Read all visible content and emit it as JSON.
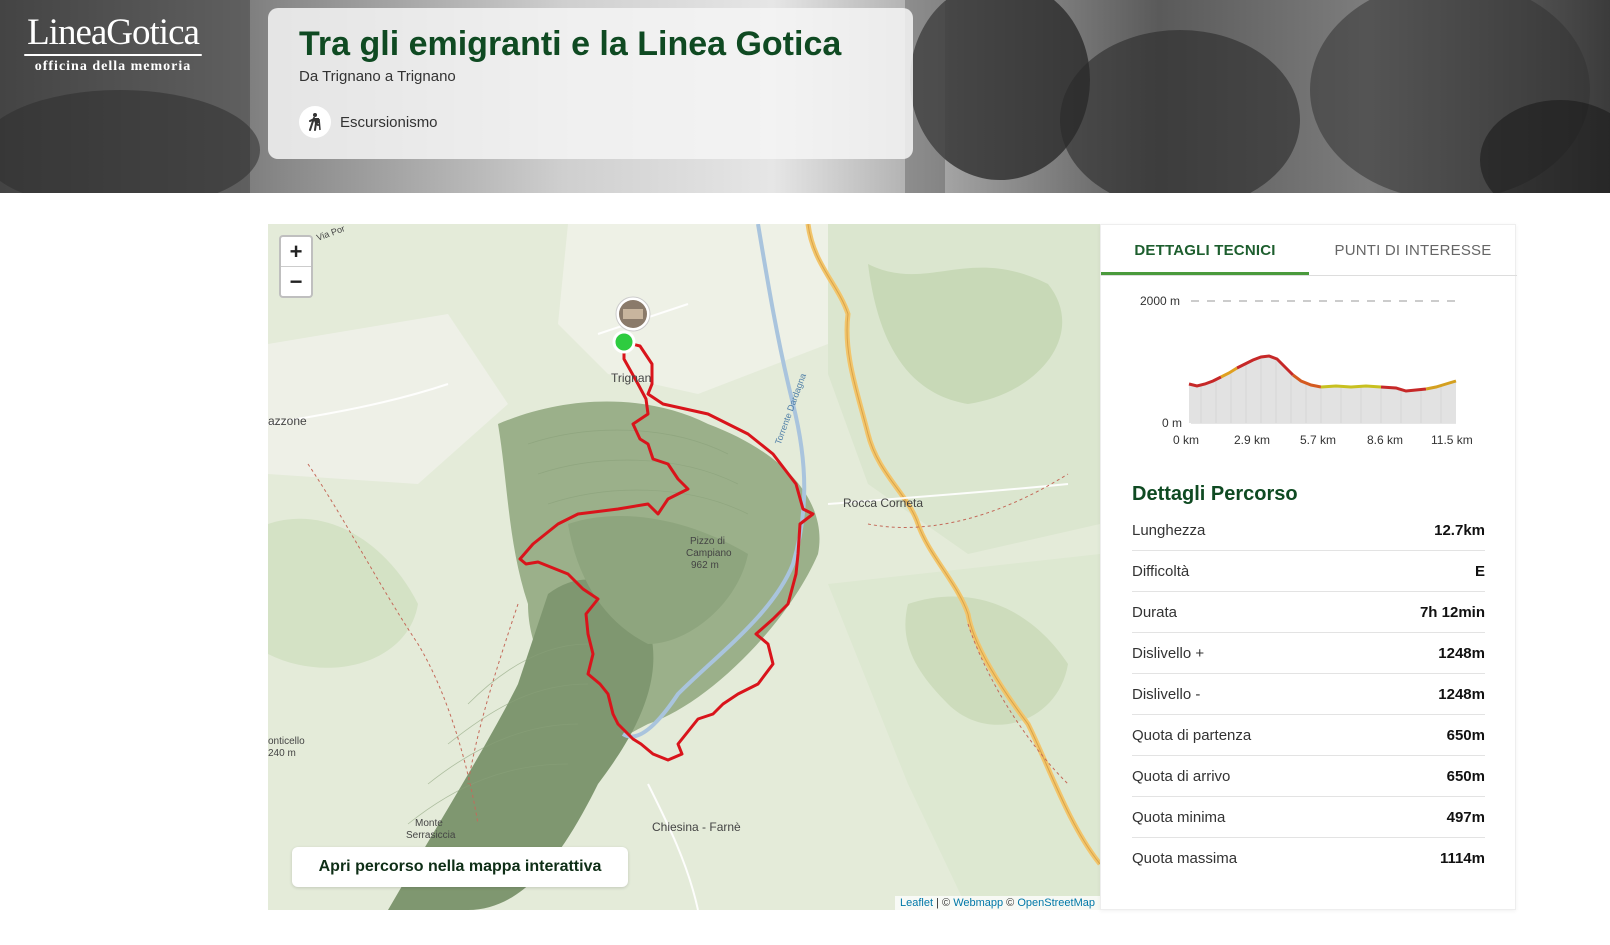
{
  "hero": {
    "logo": {
      "name": "LineaGotica",
      "tagline": "officina della memoria"
    },
    "title": "Tra gli emigranti e la Linea Gotica",
    "subtitle": "Da Trignano a Trignano",
    "activity": {
      "icon": "hiking-icon",
      "label": "Escursionismo"
    }
  },
  "map": {
    "zoom_in": "+",
    "zoom_out": "−",
    "labels": {
      "trignano": "Trignan",
      "rocca": "Rocca Corneta",
      "pizzo": "Pizzo di",
      "pizzo2": "Campiano",
      "pizzo3": "962 m",
      "chiesina": "Chiesina - Farnè",
      "monte": "Monte",
      "monte2": "Serrasiccia",
      "ponticello": "onticello",
      "ponticello2": "240 m",
      "azzone": "azzone",
      "via_por": "Via Por",
      "torrente": "Torrente Dardagna"
    },
    "open_button": "Apri percorso nella mappa interattiva",
    "attribution": {
      "leaflet": "Leaflet",
      "sep": " | © ",
      "webmapp": "Webmapp",
      "sep2": " © ",
      "osm": "OpenStreetMap"
    },
    "colors": {
      "route": "#d9141b",
      "start": "#2ecc40"
    }
  },
  "panel": {
    "tabs": [
      {
        "label": "DETTAGLI TECNICI",
        "active": true
      },
      {
        "label": "PUNTI DI INTERESSE",
        "active": false
      }
    ],
    "profile": {
      "y_top_label": "2000 m",
      "y_bottom_label": "0 m",
      "x_labels": [
        "0 km",
        "2.9 km",
        "5.7 km",
        "8.6 km",
        "11.5 km"
      ]
    },
    "details_title": "Dettagli Percorso",
    "details": [
      {
        "key": "Lunghezza",
        "value": "12.7km"
      },
      {
        "key": "Difficoltà",
        "value": "E"
      },
      {
        "key": "Durata",
        "value": "7h 12min"
      },
      {
        "key": "Dislivello +",
        "value": "1248m"
      },
      {
        "key": "Dislivello -",
        "value": "1248m"
      },
      {
        "key": "Quota di partenza",
        "value": "650m"
      },
      {
        "key": "Quota di arrivo",
        "value": "650m"
      },
      {
        "key": "Quota minima",
        "value": "497m"
      },
      {
        "key": "Quota massima",
        "value": "1114m"
      }
    ]
  }
}
